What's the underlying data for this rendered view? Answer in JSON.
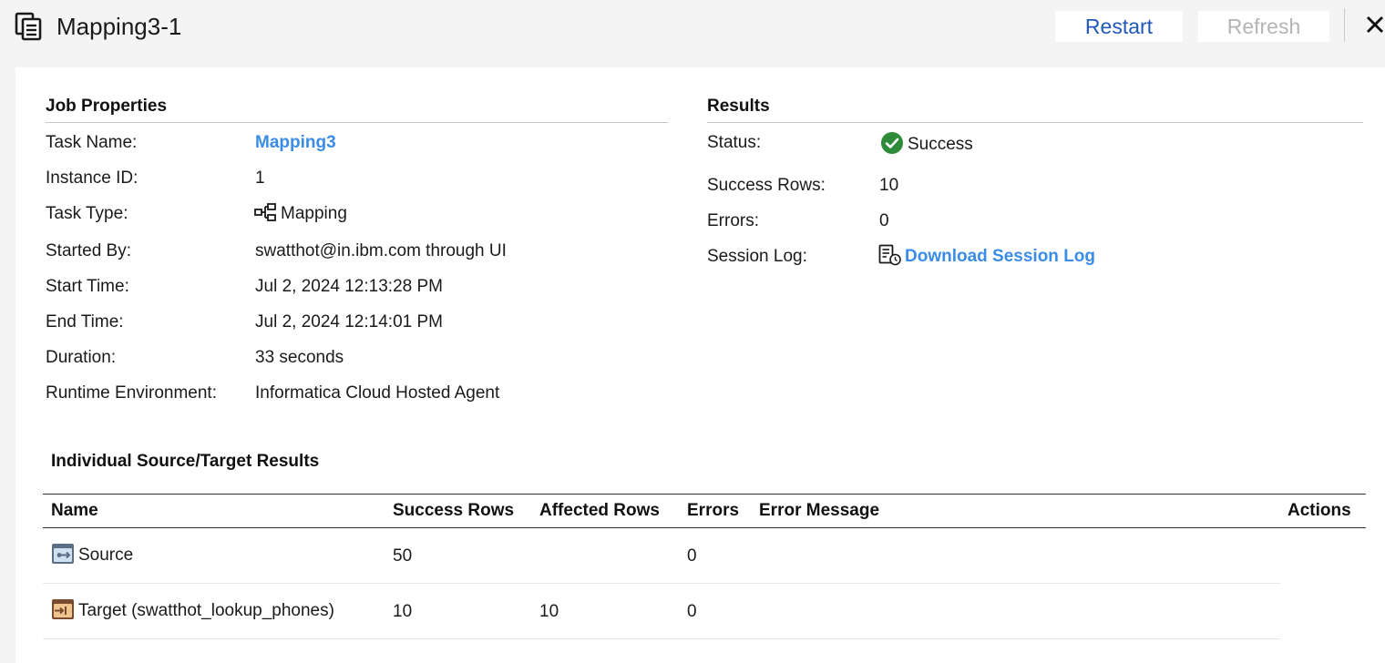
{
  "header": {
    "title": "Mapping3-1",
    "restart_label": "Restart",
    "refresh_label": "Refresh",
    "title_icon": "task-document-icon",
    "close_icon": "close-icon"
  },
  "job_properties": {
    "heading": "Job Properties",
    "task_name": {
      "label": "Task Name:",
      "value": "Mapping3"
    },
    "instance_id": {
      "label": "Instance ID:",
      "value": "1"
    },
    "task_type": {
      "label": "Task Type:",
      "value": "Mapping",
      "icon": "mapping-icon"
    },
    "started_by": {
      "label": "Started By:",
      "value": "swatthot@in.ibm.com through UI"
    },
    "start_time": {
      "label": "Start Time:",
      "value": "Jul 2, 2024 12:13:28 PM"
    },
    "end_time": {
      "label": "End Time:",
      "value": "Jul 2, 2024 12:14:01 PM"
    },
    "duration": {
      "label": "Duration:",
      "value": "33 seconds"
    },
    "runtime_env": {
      "label": "Runtime Environment:",
      "value": "Informatica Cloud Hosted Agent"
    }
  },
  "results": {
    "heading": "Results",
    "status": {
      "label": "Status:",
      "value": "Success",
      "icon": "success-check-icon"
    },
    "success_rows": {
      "label": "Success Rows:",
      "value": "10"
    },
    "errors": {
      "label": "Errors:",
      "value": "0"
    },
    "session_log": {
      "label": "Session Log:",
      "value": "Download Session Log",
      "icon": "session-log-icon"
    }
  },
  "individual": {
    "heading": "Individual Source/Target Results",
    "columns": {
      "name": "Name",
      "success_rows": "Success Rows",
      "affected_rows": "Affected Rows",
      "errors": "Errors",
      "error_message": "Error Message",
      "actions": "Actions"
    },
    "rows": [
      {
        "name": "Source",
        "icon": "source-icon",
        "success_rows": "50",
        "affected_rows": "",
        "errors": "0",
        "error_message": ""
      },
      {
        "name": "Target (swatthot_lookup_phones)",
        "icon": "target-icon",
        "success_rows": "10",
        "affected_rows": "10",
        "errors": "0",
        "error_message": ""
      }
    ]
  },
  "colors": {
    "link": "#3a8de6",
    "primary_button_text": "#1f58b8",
    "disabled_text": "#b5b5b5",
    "success_green": "#2e8b3a"
  }
}
